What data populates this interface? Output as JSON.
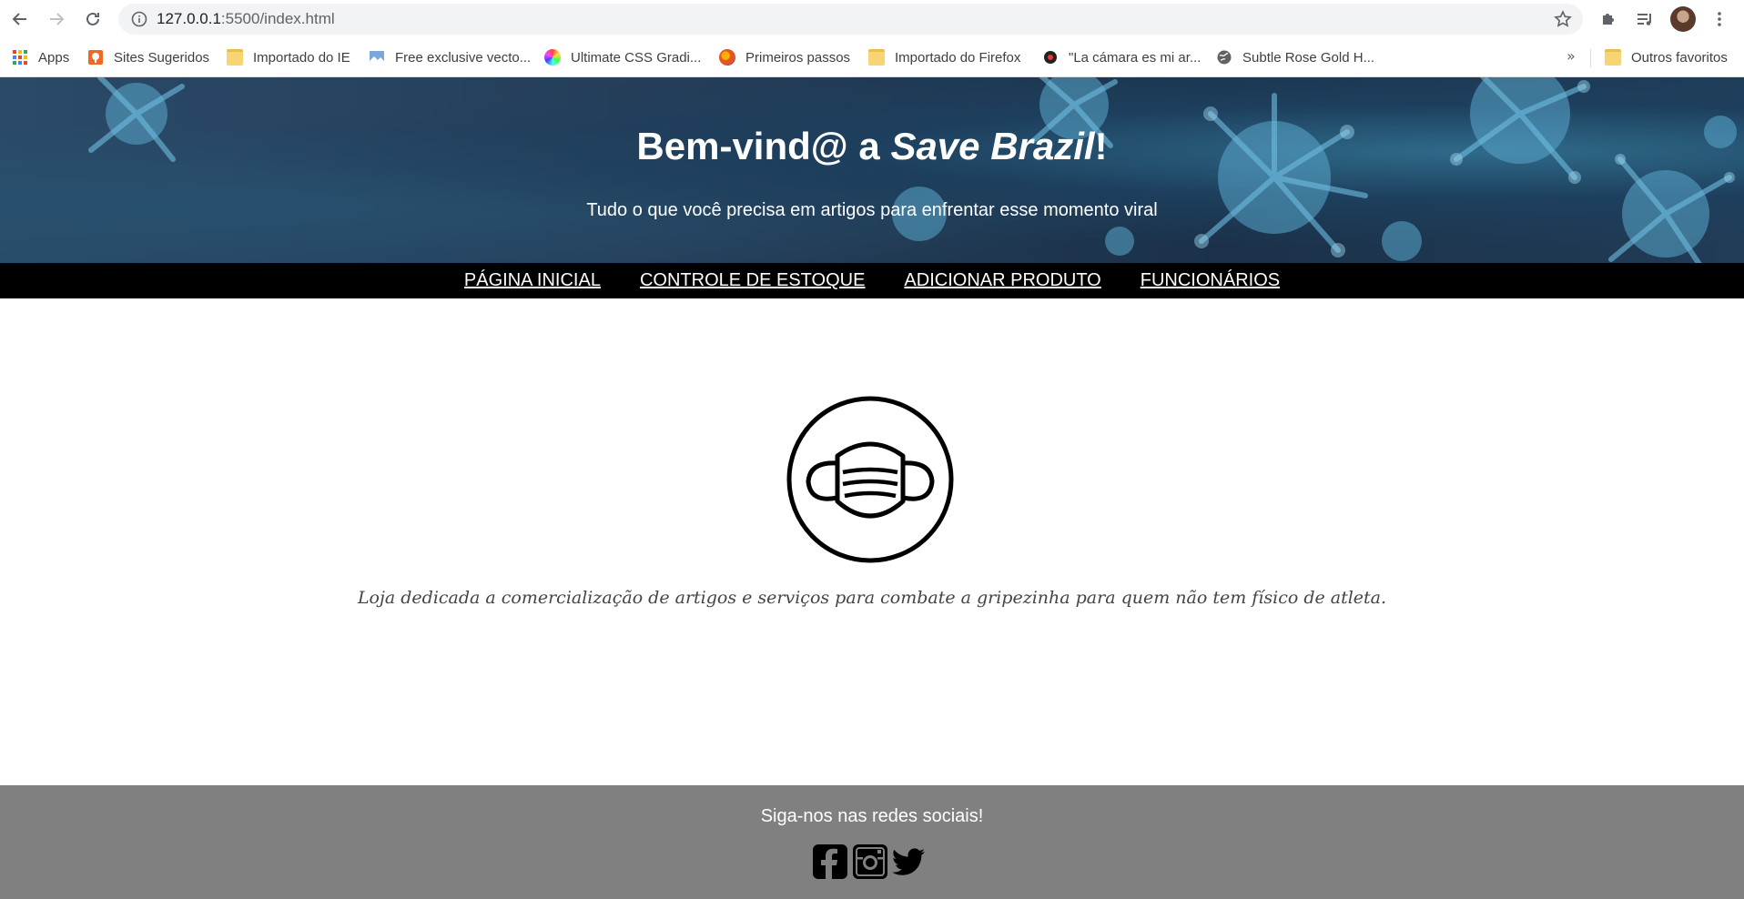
{
  "browser": {
    "url_host": "127.0.0.1",
    "url_path": ":5500/index.html",
    "bookmarks": [
      {
        "label": "Apps",
        "icon": "apps-grid-icon"
      },
      {
        "label": "Sites Sugeridos",
        "icon": "suggested-sites-icon"
      },
      {
        "label": "Importado do IE",
        "icon": "folder-icon"
      },
      {
        "label": "Free exclusive vecto...",
        "icon": "vector-site-icon"
      },
      {
        "label": "Ultimate CSS Gradi...",
        "icon": "gradient-site-icon"
      },
      {
        "label": "Primeiros passos",
        "icon": "firefox-icon"
      },
      {
        "label": "Importado do Firefox",
        "icon": "folder-icon"
      },
      {
        "label": "\"La cámara es mi ar...",
        "icon": "camera-site-icon"
      },
      {
        "label": "Subtle Rose Gold H...",
        "icon": "globe-icon"
      }
    ],
    "other_bookmarks": "Outros favoritos",
    "more": "»"
  },
  "hero": {
    "title_prefix": "Bem-vind@ a ",
    "title_emphasis": "Save Brazil",
    "title_suffix": "!",
    "subtitle": "Tudo o que você precisa em artigos para enfrentar esse momento viral"
  },
  "menu": {
    "items": [
      {
        "label": "PÁGINA INICIAL"
      },
      {
        "label": "CONTROLE DE ESTOQUE"
      },
      {
        "label": "ADICIONAR PRODUTO"
      },
      {
        "label": "FUNCIONÁRIOS"
      }
    ]
  },
  "main": {
    "logo_icon": "face-mask-icon",
    "tagline": "Loja dedicada a comercialização de artigos e serviços para combate a gripezinha para quem não tem físico de atleta."
  },
  "footer": {
    "follow_text": "Siga-nos nas redes sociais!",
    "social": [
      "facebook-icon",
      "instagram-icon",
      "twitter-icon"
    ]
  }
}
